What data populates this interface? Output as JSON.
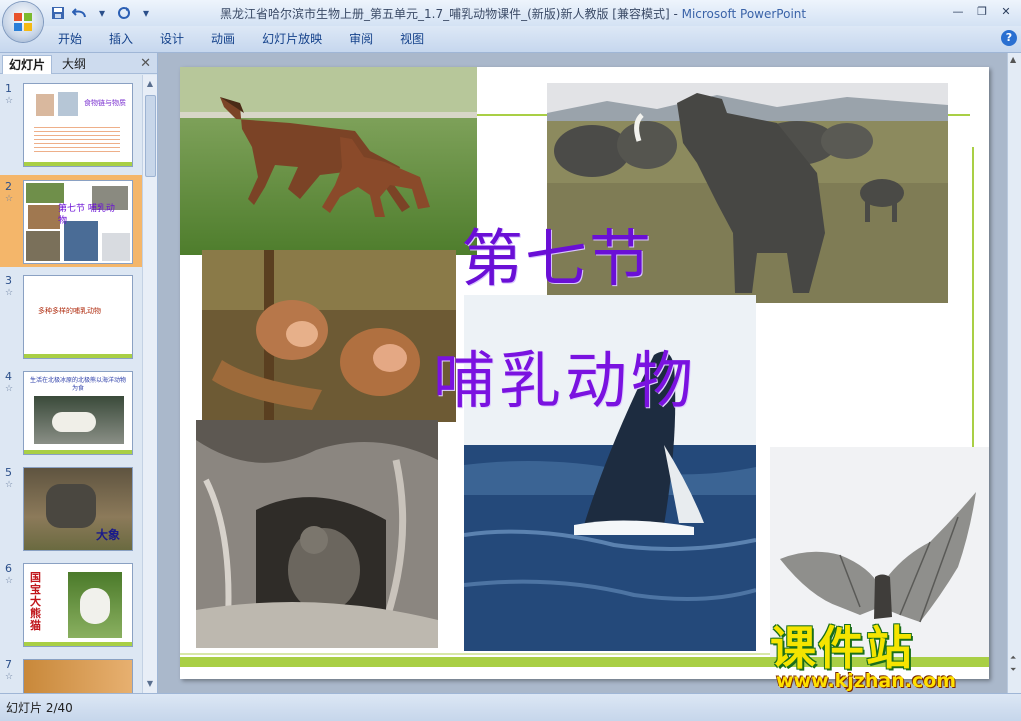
{
  "window": {
    "title": "黑龙江省哈尔滨市生物上册_第五单元_1.7_哺乳动物课件_(新版)新人教版 [兼容模式] - ",
    "app_name": "Microsoft PowerPoint"
  },
  "ribbon": {
    "tabs": [
      "开始",
      "插入",
      "设计",
      "动画",
      "幻灯片放映",
      "审阅",
      "视图"
    ]
  },
  "panel": {
    "tab_slides": "幻灯片",
    "tab_outline": "大纲",
    "thumbs": [
      {
        "num": "1",
        "text": "食物链与物质"
      },
      {
        "num": "2",
        "text": "第七节 哺乳动物"
      },
      {
        "num": "3",
        "text": "多种多样的哺乳动物"
      },
      {
        "num": "4",
        "text": "生活在北极冰原的北极熊以海洋动物为食"
      },
      {
        "num": "5",
        "text": "大象"
      },
      {
        "num": "6",
        "text": "国宝大熊猫"
      },
      {
        "num": "7",
        "text": ""
      }
    ]
  },
  "slide": {
    "title_line1": "第七节",
    "title_line2": "哺乳动物"
  },
  "watermark": {
    "line1": "课件站",
    "line2": "www.kjzhan.com"
  },
  "status": {
    "slide_counter": "幻灯片 2/40"
  },
  "colors": {
    "title_purple": "#6a0fd6",
    "accent_green": "#a9cf45",
    "selected_thumb": "#f4b66a"
  }
}
